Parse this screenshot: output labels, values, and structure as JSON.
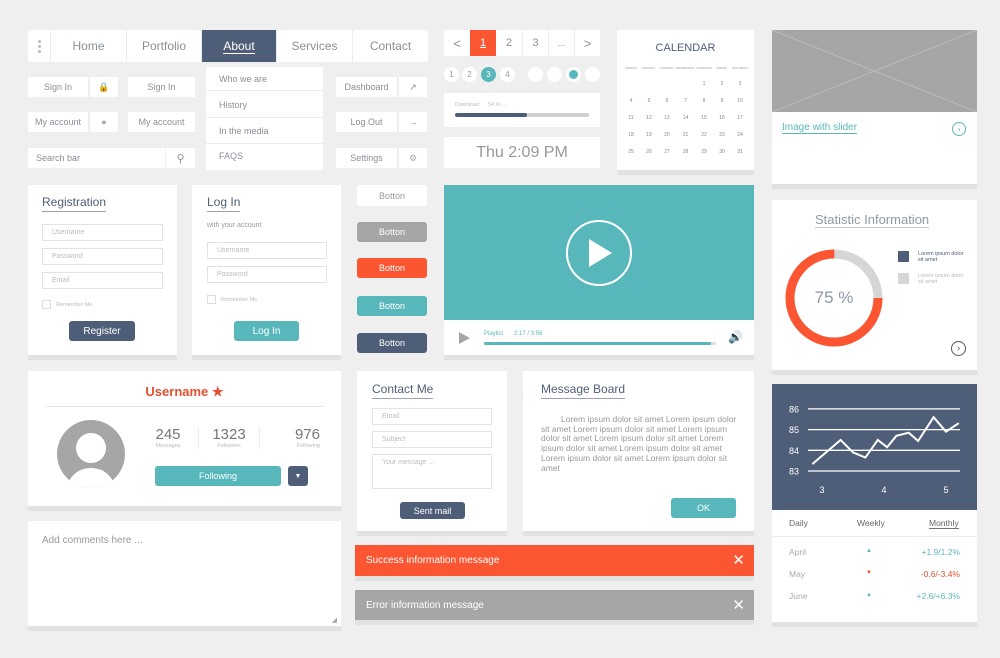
{
  "colors": {
    "background": "#efefef",
    "navy": "#4f5e78",
    "orange": "#fb5531",
    "teal": "#58b7bb",
    "gray": "#a6a6a6"
  },
  "nav": {
    "menu_icon": "vertical-dots-icon",
    "items": [
      "Home",
      "Portfolio",
      "About",
      "Services",
      "Contact"
    ],
    "active": "About"
  },
  "dropdown": {
    "items": [
      "Who we are",
      "History",
      "In the media",
      "FAQS"
    ]
  },
  "small_buttons": {
    "sign_in": "Sign In",
    "my_account": "My account",
    "search_placeholder": "Search bar",
    "dashboard": "Dashboard",
    "log_out": "Log Out",
    "settings": "Settings"
  },
  "pagination": {
    "prev": "<",
    "pages": [
      "1",
      "2",
      "3",
      "..."
    ],
    "next": ">",
    "active": "1"
  },
  "steps": {
    "items": [
      "1",
      "2",
      "3",
      "4"
    ],
    "active": "3",
    "dots_active_index": 2
  },
  "download": {
    "label": "Download",
    "value": "54 % ...",
    "percent": 54
  },
  "clock": {
    "text": "Thu 2:09 PM"
  },
  "calendar": {
    "title": "CALENDAR",
    "weekdays": [
      "SUNDAY",
      "MONDAY",
      "TUESDAY",
      "WEDNESDAY",
      "THURSDAY",
      "FRIDAY",
      "SATURDAY"
    ],
    "first_weekday": 4,
    "days": 31
  },
  "image_slider": {
    "label": "Image with slider"
  },
  "registration": {
    "title": "Registration",
    "username": "Username",
    "password": "Password",
    "email": "Email",
    "remember": "Remember Me",
    "button": "Register"
  },
  "login": {
    "title": "Log In",
    "subtitle": "with your account",
    "username": "Username",
    "password": "Password",
    "remember": "Remember Me",
    "button": "Log In"
  },
  "buttons": [
    "Botton",
    "Botton",
    "Botton",
    "Botton",
    "Botton"
  ],
  "video": {
    "playlist": "Playlist",
    "time": "2:17 / 3:56",
    "progress": 98
  },
  "statistic": {
    "title": "Statistic Information",
    "percent": 75,
    "percent_label": "75 %",
    "legend": [
      "Lorem ipsum dolor sit amet",
      "Lorem ipsum dolor sit amet"
    ]
  },
  "profile": {
    "username": "Username",
    "stats": [
      {
        "value": "245",
        "label": "Messages"
      },
      {
        "value": "1323",
        "label": "Followers"
      },
      {
        "value": "976",
        "label": "Following"
      }
    ],
    "follow_button": "Following"
  },
  "comments": {
    "placeholder": "Add comments here ..."
  },
  "contact": {
    "title": "Contact Me",
    "email": "Email",
    "subject": "Subject",
    "message": "Your message ...",
    "button": "Sent mail"
  },
  "message_board": {
    "title": "Message Board",
    "text": "Lorem ipsum dolor sit amet Lorem ipsum dolor sit amet Lorem ipsum dolor sit amet Lorem ipsum dolor sit amet Lorem ipsum dolor sit amet Lorem ipsum dolor sit amet Lorem ipsum dolor sit amet Lorem ipsum dolor sit amet Lorem ipsum dolor sit amet",
    "button": "OK"
  },
  "alerts": {
    "success": "Success information message",
    "error": "Error information message"
  },
  "chart_data": {
    "type": "line",
    "x": [
      2.85,
      3.3,
      3.5,
      3.7,
      3.9,
      4.05,
      4.2,
      4.4,
      4.55,
      4.8,
      5.0,
      5.2
    ],
    "y": [
      83.35,
      84.5,
      83.9,
      83.65,
      84.5,
      84.15,
      84.7,
      84.85,
      84.45,
      85.6,
      84.9,
      85.3
    ],
    "xticks": [
      "3",
      "4",
      "5"
    ],
    "yticks": [
      "86",
      "85",
      "84",
      "83"
    ],
    "ylim": [
      83,
      86
    ],
    "grid": true
  },
  "stats_tabs": {
    "tabs": [
      "Daily",
      "Weekly",
      "Monthly"
    ],
    "active": "Monthly",
    "rows": [
      {
        "month": "April",
        "trend": "up",
        "value": "+1.9/1.2%"
      },
      {
        "month": "May",
        "trend": "down",
        "value": "-0.6/-3.4%"
      },
      {
        "month": "June",
        "trend": "up",
        "value": "+2.6/+6.3%"
      }
    ]
  }
}
